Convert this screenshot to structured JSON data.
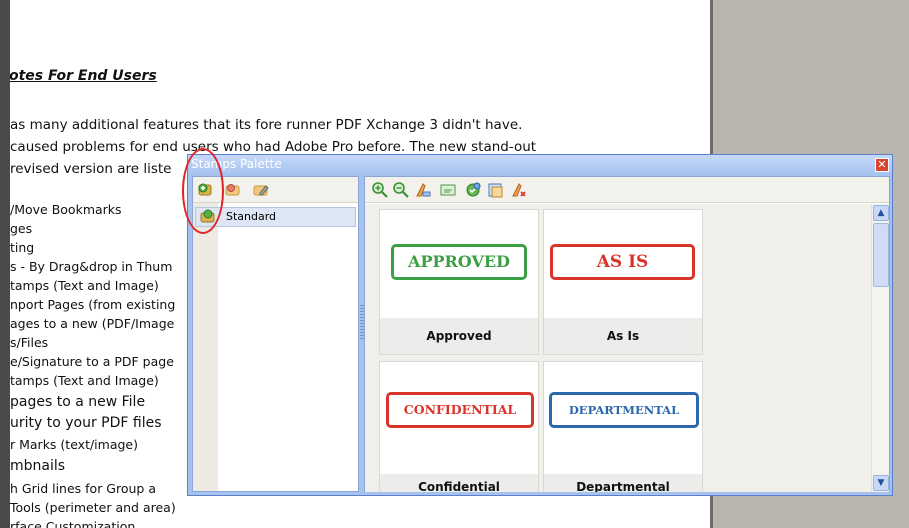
{
  "document": {
    "heading": "otes For End Users",
    "paragraph": [
      "as many additional features that its fore runner PDF Xchange 3 didn't have.",
      "caused problems for end users who had Adobe Pro before. The new stand-out",
      "revised version are liste"
    ],
    "list_items": [
      "/Move Bookmarks",
      "ges",
      "ting",
      "s - By Drag&drop in Thum",
      "tamps (Text and Image)",
      "nport Pages (from existing",
      "ages to a new (PDF/Image",
      "s/Files",
      "e/Signature to a PDF page",
      "tamps (Text and Image)",
      "pages to a new File",
      "urity to your PDF files",
      "r Marks (text/image)",
      "mbnails",
      "h Grid lines for Group a",
      "Tools (perimeter and area)",
      "rface Customization"
    ]
  },
  "stamps_palette": {
    "title": "Stamps Palette",
    "close_symbol": "✕",
    "left_toolbar": [
      "add-category-icon",
      "remove-category-icon",
      "edit-category-icon"
    ],
    "categories": [
      {
        "label": "Standard",
        "selected": true
      }
    ],
    "right_toolbar": [
      "zoom-in-icon",
      "zoom-out-icon",
      "new-stamp-icon",
      "edit-stamp-icon",
      "stamp-properties-icon",
      "copy-stamp-icon",
      "delete-stamp-icon"
    ],
    "stamps": [
      {
        "badge": "APPROVED",
        "caption": "Approved",
        "color": "#3aa043"
      },
      {
        "badge": "AS IS",
        "caption": "As Is",
        "color": "#d9342b"
      },
      {
        "badge": "CONFIDENTIAL",
        "caption": "Confidential",
        "color": "#d9342b"
      },
      {
        "badge": "DEPARTMENTAL",
        "caption": "Departmental",
        "color": "#2a67ad"
      }
    ],
    "scroll_up": "▲",
    "scroll_down": "▼"
  }
}
